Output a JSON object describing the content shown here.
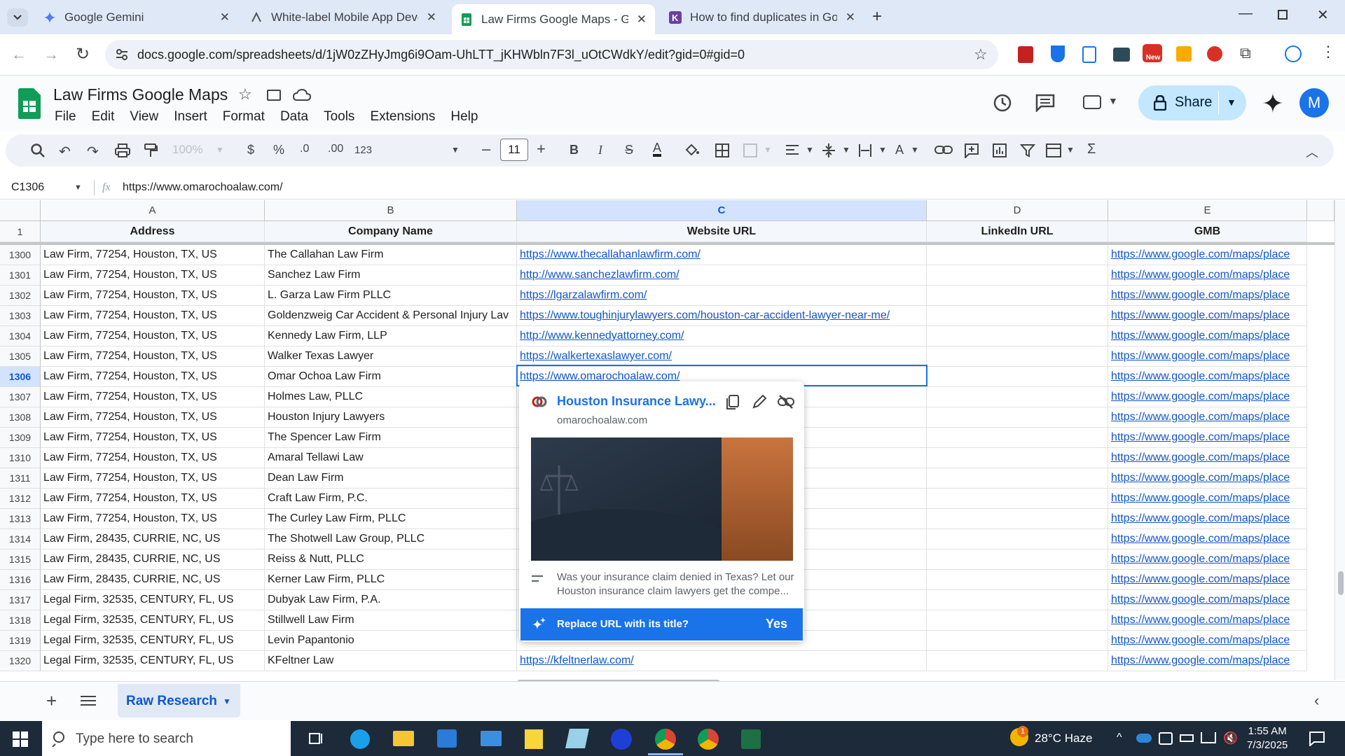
{
  "browser": {
    "tabs": [
      {
        "title": "Google Gemini"
      },
      {
        "title": "White-label Mobile App Develo"
      },
      {
        "title": "Law Firms Google Maps - Goog"
      },
      {
        "title": "How to find duplicates in Goog"
      }
    ],
    "url": "docs.google.com/spreadsheets/d/1jW0zZHyJmg6i9Oam-UhLTT_jKHWbln7F3l_uOtCWdkY/edit?gid=0#gid=0",
    "ext_new_badge": "New"
  },
  "sheets": {
    "doc_title": "Law Firms Google Maps",
    "menu": [
      "File",
      "Edit",
      "View",
      "Insert",
      "Format",
      "Data",
      "Tools",
      "Extensions",
      "Help"
    ],
    "share_label": "Share",
    "avatar_letter": "M",
    "toolbar": {
      "zoom": "100%",
      "currency": "$",
      "percent": "%",
      "dec_decrease": ".0",
      "dec_increase": ".00",
      "number_format": "123",
      "font_size": "11",
      "bold": "B",
      "italic": "I",
      "strike": "S",
      "text_color": "A"
    },
    "name_box": "C1306",
    "fx_label": "fx",
    "formula": "https://www.omarochoalaw.com/",
    "columns": [
      "A",
      "B",
      "C",
      "D",
      "E"
    ],
    "header_row": {
      "num": "1",
      "cells": [
        "Address",
        "Company Name",
        "Website URL",
        "LinkedIn URL",
        "GMB"
      ]
    },
    "rows": [
      {
        "num": "1300",
        "address": "Law Firm, 77254, Houston, TX, US",
        "company": "The Callahan Law Firm",
        "website": "https://www.thecallahanlawfirm.com/",
        "linkedin": "",
        "gmb": "https://www.google.com/maps/place"
      },
      {
        "num": "1301",
        "address": "Law Firm, 77254, Houston, TX, US",
        "company": "Sanchez Law Firm",
        "website": "http://www.sanchezlawfirm.com/",
        "linkedin": "",
        "gmb": "https://www.google.com/maps/place"
      },
      {
        "num": "1302",
        "address": "Law Firm, 77254, Houston, TX, US",
        "company": "L. Garza Law Firm PLLC",
        "website": "https://lgarzalawfirm.com/",
        "linkedin": "",
        "gmb": "https://www.google.com/maps/place"
      },
      {
        "num": "1303",
        "address": "Law Firm, 77254, Houston, TX, US",
        "company": "Goldenzweig Car Accident & Personal Injury Lav",
        "website": "https://www.toughinjurylawyers.com/houston-car-accident-lawyer-near-me/",
        "linkedin": "",
        "gmb": "https://www.google.com/maps/place"
      },
      {
        "num": "1304",
        "address": "Law Firm, 77254, Houston, TX, US",
        "company": "Kennedy Law Firm, LLP",
        "website": "http://www.kennedyattorney.com/",
        "linkedin": "",
        "gmb": "https://www.google.com/maps/place"
      },
      {
        "num": "1305",
        "address": "Law Firm, 77254, Houston, TX, US",
        "company": "Walker Texas Lawyer",
        "website": "https://walkertexaslawyer.com/",
        "linkedin": "",
        "gmb": "https://www.google.com/maps/place"
      },
      {
        "num": "1306",
        "address": "Law Firm, 77254, Houston, TX, US",
        "company": "Omar Ochoa Law Firm",
        "website": "https://www.omarochoalaw.com/",
        "linkedin": "",
        "gmb": "https://www.google.com/maps/place"
      },
      {
        "num": "1307",
        "address": "Law Firm, 77254, Houston, TX, US",
        "company": "Holmes Law, PLLC",
        "website": "",
        "linkedin": "",
        "gmb": "https://www.google.com/maps/place"
      },
      {
        "num": "1308",
        "address": "Law Firm, 77254, Houston, TX, US",
        "company": "Houston Injury Lawyers",
        "website": "",
        "linkedin": "",
        "gmb": "https://www.google.com/maps/place"
      },
      {
        "num": "1309",
        "address": "Law Firm, 77254, Houston, TX, US",
        "company": "The Spencer Law Firm",
        "website": "",
        "linkedin": "",
        "gmb": "https://www.google.com/maps/place"
      },
      {
        "num": "1310",
        "address": "Law Firm, 77254, Houston, TX, US",
        "company": "Amaral Tellawi Law",
        "website": "",
        "linkedin": "",
        "gmb": "https://www.google.com/maps/place"
      },
      {
        "num": "1311",
        "address": "Law Firm, 77254, Houston, TX, US",
        "company": "Dean Law Firm",
        "website": "",
        "linkedin": "",
        "gmb": "https://www.google.com/maps/place"
      },
      {
        "num": "1312",
        "address": "Law Firm, 77254, Houston, TX, US",
        "company": "Craft Law Firm, P.C.",
        "website": "",
        "linkedin": "",
        "gmb": "https://www.google.com/maps/place"
      },
      {
        "num": "1313",
        "address": "Law Firm, 77254, Houston, TX, US",
        "company": "The Curley Law Firm, PLLC",
        "website": "",
        "linkedin": "",
        "gmb": "https://www.google.com/maps/place"
      },
      {
        "num": "1314",
        "address": "Law Firm, 28435, CURRIE, NC, US",
        "company": "The Shotwell Law Group, PLLC",
        "website": "",
        "linkedin": "",
        "gmb": "https://www.google.com/maps/place"
      },
      {
        "num": "1315",
        "address": "Law Firm, 28435, CURRIE, NC, US",
        "company": "Reiss & Nutt, PLLC",
        "website": "",
        "linkedin": "",
        "gmb": "https://www.google.com/maps/place"
      },
      {
        "num": "1316",
        "address": "Law Firm, 28435, CURRIE, NC, US",
        "company": "Kerner Law Firm, PLLC",
        "website": "",
        "linkedin": "",
        "gmb": "https://www.google.com/maps/place"
      },
      {
        "num": "1317",
        "address": "Legal Firm, 32535, CENTURY, FL, US",
        "company": "Dubyak Law Firm, P.A.",
        "website": "",
        "linkedin": "",
        "gmb": "https://www.google.com/maps/place"
      },
      {
        "num": "1318",
        "address": "Legal Firm, 32535, CENTURY, FL, US",
        "company": "Stillwell Law Firm",
        "website": "",
        "linkedin": "",
        "gmb": "https://www.google.com/maps/place"
      },
      {
        "num": "1319",
        "address": "Legal Firm, 32535, CENTURY, FL, US",
        "company": "Levin Papantonio",
        "website": "",
        "linkedin": "",
        "gmb": "https://www.google.com/maps/place"
      },
      {
        "num": "1320",
        "address": "Legal Firm, 32535, CENTURY, FL, US",
        "company": "KFeltner Law",
        "website": "https://kfeltnerlaw.com/",
        "linkedin": "",
        "gmb": "https://www.google.com/maps/place"
      }
    ],
    "link_preview": {
      "title": "Houston Insurance Lawy...",
      "domain": "omarochoalaw.com",
      "description": "Was your insurance claim denied in Texas? Let our Houston insurance claim lawyers get the compe...",
      "suggestion": "Replace URL with its title?",
      "yes_label": "Yes"
    },
    "sheet_tab": "Raw Research"
  },
  "taskbar": {
    "search_placeholder": "Type here to search",
    "weather": "28°C  Haze",
    "time": "1:55 AM",
    "date": "7/3/2025",
    "notification_count": "1"
  },
  "colors": {
    "accent": "#1a73e8",
    "link": "#1155cc",
    "selection": "#d3e3fd",
    "sheets_green": "#0f9d58"
  }
}
